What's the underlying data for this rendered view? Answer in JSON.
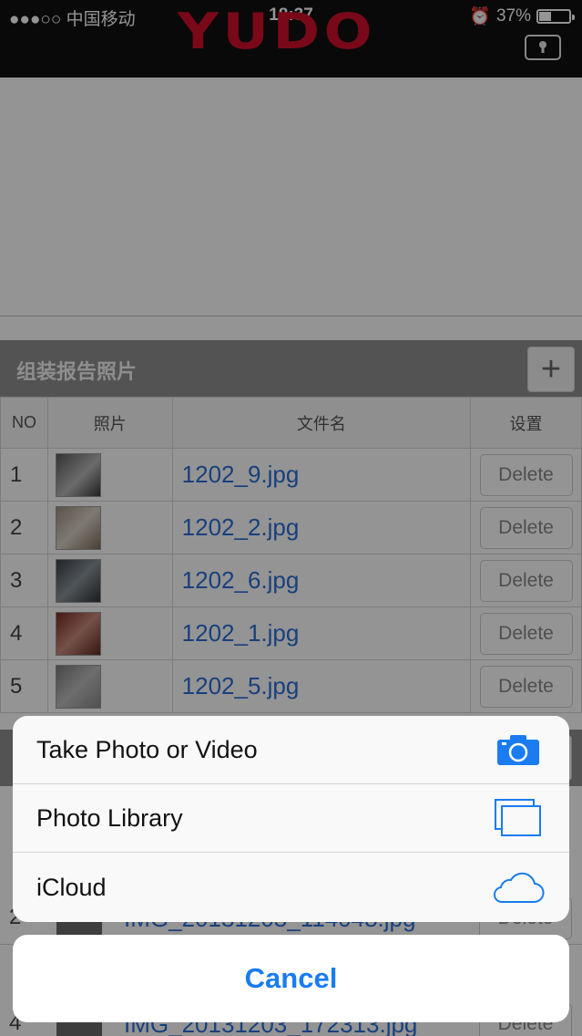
{
  "status_bar": {
    "carrier": "●●●○○ 中国移动",
    "time": "18:37",
    "battery": "37%"
  },
  "header": {
    "logo": "YUDO",
    "lock_icon": "lock-icon"
  },
  "assembly_section": {
    "title": "组装报告照片",
    "add_label": "+",
    "columns": [
      "NO",
      "照片",
      "文件名",
      "设置"
    ],
    "rows": [
      {
        "no": "1",
        "file": "1202_9.jpg",
        "action": "Delete"
      },
      {
        "no": "2",
        "file": "1202_2.jpg",
        "action": "Delete"
      },
      {
        "no": "3",
        "file": "1202_6.jpg",
        "action": "Delete"
      },
      {
        "no": "4",
        "file": "1202_1.jpg",
        "action": "Delete"
      },
      {
        "no": "5",
        "file": "1202_5.jpg",
        "action": "Delete"
      }
    ]
  },
  "second_section": {
    "rows": [
      {
        "no": "2",
        "file": "IMG_20131203_114048.jpg",
        "action": "Delete"
      },
      {
        "no": "4",
        "file": "IMG_20131203_172313.jpg",
        "action": "Delete"
      }
    ]
  },
  "action_sheet": {
    "items": [
      {
        "label": "Take Photo or Video",
        "icon": "camera-icon"
      },
      {
        "label": "Photo Library",
        "icon": "photo-library-icon"
      },
      {
        "label": "iCloud",
        "icon": "cloud-icon"
      }
    ],
    "cancel_label": "Cancel"
  },
  "colors": {
    "accent": "#1a7cf0",
    "brand": "#d0102c",
    "link": "#2b6fd6"
  }
}
